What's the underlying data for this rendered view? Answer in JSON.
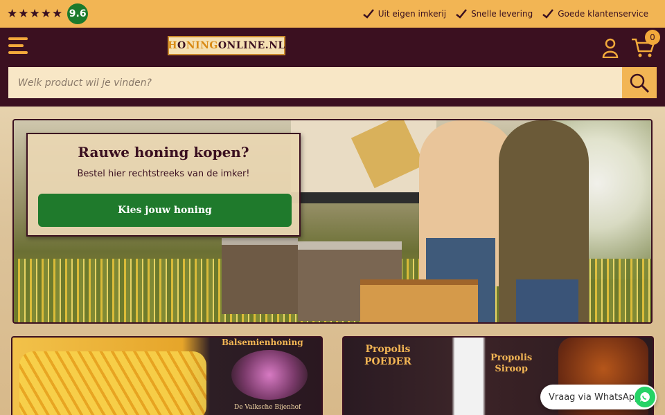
{
  "topbar": {
    "stars": "★★★★★",
    "rating_score": "9.6",
    "usps": [
      {
        "label": "Uit eigen imkerij",
        "icon": "check-icon"
      },
      {
        "label": "Snelle levering",
        "icon": "check-icon"
      },
      {
        "label": "Goede klantenservice",
        "icon": "check-icon"
      }
    ]
  },
  "header": {
    "logo": {
      "part1": "H",
      "part2": "O",
      "part3": "NING",
      "part4": "ONLINE.NL"
    },
    "cart_count": "0",
    "search": {
      "placeholder": "Welk product wil je vinden?"
    }
  },
  "hero": {
    "title": "Rauwe honing kopen?",
    "subtitle": "Bestel hier rechtstreeks van de imker!",
    "cta_label": "Kies jouw honing"
  },
  "tiles": {
    "left": {
      "label": "Balsemienhoning",
      "sublabel": "De Valksche Bijenhof"
    },
    "right": {
      "label1": "Propolis",
      "label1b": "POEDER",
      "label2": "Propolis",
      "label2b": "Siroop"
    }
  },
  "whatsapp": {
    "label": "Vraag via WhatsApp"
  },
  "colors": {
    "brand_dark": "#3b1020",
    "brand_amber": "#f2b554",
    "cta_green": "#1f7a2c"
  }
}
